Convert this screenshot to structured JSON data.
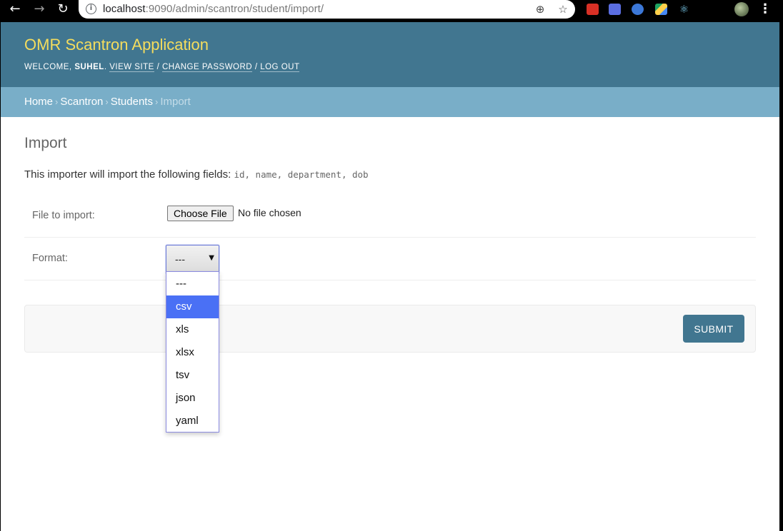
{
  "browser": {
    "url_host": "localhost",
    "url_path": ":9090/admin/scantron/student/import/"
  },
  "header": {
    "site_title": "OMR Scantron Application",
    "welcome": "WELCOME,",
    "username": "SUHEL",
    "view_site": "VIEW SITE",
    "change_password": "CHANGE PASSWORD",
    "log_out": "LOG OUT",
    "separator": "/"
  },
  "breadcrumbs": {
    "items": [
      "Home",
      "Scantron",
      "Students"
    ],
    "current": "Import",
    "separator": "›"
  },
  "main": {
    "title": "Import",
    "intro_text": "This importer will import the following fields:",
    "fields": "id, name, department, dob",
    "file_label": "File to import:",
    "choose_file_label": "Choose File",
    "no_file_text": "No file chosen",
    "format_label": "Format:",
    "format_selected": "---",
    "submit_label": "SUBMIT"
  },
  "dropdown": {
    "options": [
      "---",
      "csv",
      "xls",
      "xlsx",
      "tsv",
      "json",
      "yaml"
    ],
    "highlighted": "csv"
  },
  "colors": {
    "header_bg": "#417690",
    "branding": "#f5dd5d",
    "breadcrumbs_bg": "#79aec8",
    "highlight": "#4a70f5"
  },
  "icons": {
    "back": "arrow-left-icon",
    "forward": "arrow-right-icon",
    "reload": "reload-icon",
    "info": "info-icon",
    "zoom": "zoom-icon",
    "bookmark": "star-icon",
    "menu": "three-dots-icon"
  }
}
